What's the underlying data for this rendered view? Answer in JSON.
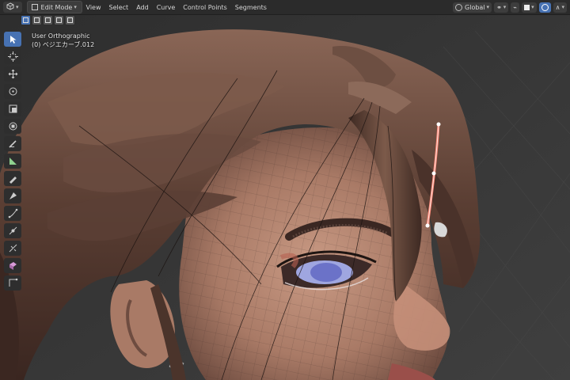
{
  "header": {
    "editor_type_icon": "cube-icon",
    "mode": "Edit Mode",
    "menus": [
      "View",
      "Select",
      "Add",
      "Curve",
      "Control Points",
      "Segments"
    ],
    "transform_orientation": "Global",
    "snap_icon": "magnet-icon",
    "pivot_icon": "circle-dot-icon",
    "falloff_icon": "falloff-curve-icon"
  },
  "select_modes": [
    "set-select-icon",
    "extend-select-icon",
    "subtract-select-icon",
    "invert-select-icon",
    "intersect-select-icon"
  ],
  "viewport": {
    "view_name": "User Orthographic",
    "object_name": "(0) ベジエカーブ.012"
  },
  "toolbar": [
    "select-box-icon",
    "cursor-icon",
    "move-icon",
    "rotate-icon",
    "scale-icon",
    "transform-icon",
    "annotate-icon",
    "measure-icon",
    "draw-icon",
    "pen-icon",
    "tilt-icon",
    "radius-icon",
    "randomize-icon",
    "extrude-icon",
    "bezier-handle-icon"
  ],
  "colors": {
    "header_bg": "#2b2b2b",
    "accent": "#4772b3",
    "selected_curve": "#ff6b6b"
  }
}
